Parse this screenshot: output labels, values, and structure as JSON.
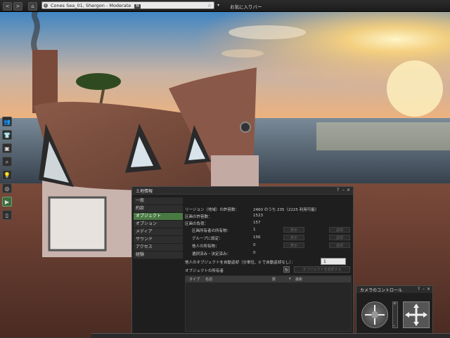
{
  "topbar": {
    "back": "<",
    "forward": ">",
    "home": "⌂",
    "location": "Cones Sea_01, Shergon - Moderate",
    "maturity": "M",
    "star": "☆",
    "dropdown": "▾",
    "favorites": "お気に入りバー"
  },
  "sidebar": {
    "items": [
      {
        "icon": "people-icon",
        "glyph": "👥"
      },
      {
        "icon": "shirt-icon",
        "glyph": "👕"
      },
      {
        "icon": "inventory-icon",
        "glyph": "▣"
      },
      {
        "icon": "search-icon",
        "glyph": "⌕"
      },
      {
        "icon": "lightbulb-icon",
        "glyph": "💡"
      },
      {
        "icon": "compass-icon",
        "glyph": "◎"
      },
      {
        "icon": "camera-icon",
        "glyph": "▶"
      },
      {
        "icon": "phone-icon",
        "glyph": "▯"
      }
    ]
  },
  "land": {
    "title": "土地情報",
    "help": "?",
    "minimize": "–",
    "close": "×",
    "tabs": [
      "一般",
      "約款",
      "オブジェクト",
      "オプション",
      "メディア",
      "サウンド",
      "アクセス",
      "経験"
    ],
    "active_tab": 2,
    "region_capacity_label": "リージョン（地域）の許容数：",
    "region_capacity_value": "2460 のうち 235（2225 利用可能）",
    "parcel_capacity_label": "区画の許容数：",
    "parcel_capacity_value": "1523",
    "parcel_total_label": "区画の負荷：",
    "parcel_total_value": "157",
    "owner_label": "区画所有者の所有物：",
    "owner_value": "1",
    "group_label": "グループに設定：",
    "group_value": "156",
    "others_label": "他人の所有物：",
    "others_value": "0",
    "selected_label": "選択済み・決定済み：",
    "selected_value": "0",
    "show_label": "表示",
    "return_label": "返却",
    "autoreturn_label": "他人のオブジェクトを自動返却（分単位、0 で自動返却なし）：",
    "autoreturn_value": "1",
    "object_owners_label": "オブジェクトの所有者",
    "refresh_glyph": "↻",
    "return_objects_label": "オブジェクトを返却する",
    "col_type": "タイプ",
    "col_name": "名前",
    "col_count": "数",
    "col_sort": "▾",
    "col_latest": "最新"
  },
  "camera": {
    "title": "カメラのコントロール",
    "help": "?",
    "minimize": "–",
    "close": "×",
    "zoom_plus": "+",
    "zoom_minus": "–"
  },
  "colors": {
    "active_tab": "#4a7a44",
    "panel_bg": "#1e1e1e",
    "sky_top": "#3f85c3",
    "sun": "#ffe58a"
  }
}
